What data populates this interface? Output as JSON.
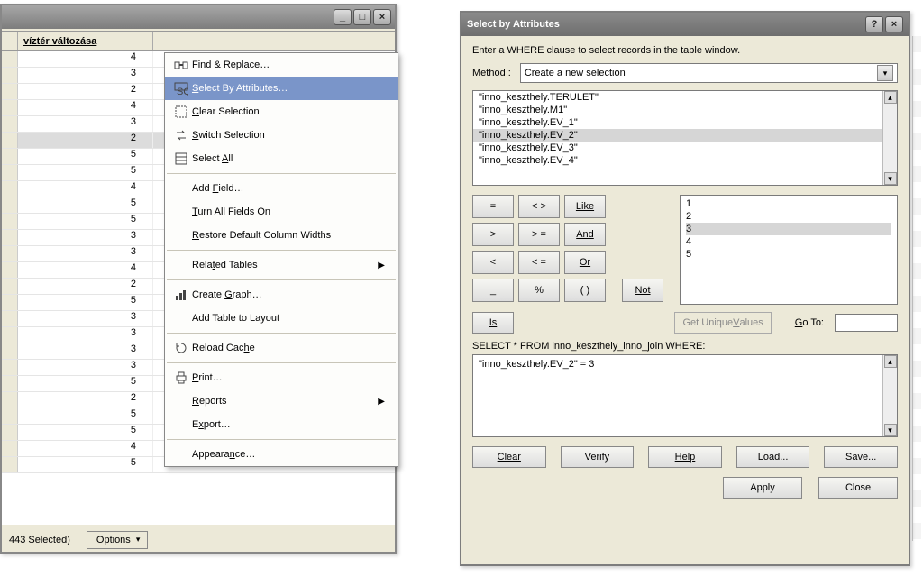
{
  "left": {
    "column_header": "víztér változása",
    "rows": [
      4,
      3,
      2,
      4,
      3,
      2,
      5,
      5,
      4,
      5,
      5,
      3,
      3,
      4,
      2,
      5,
      3,
      3,
      3,
      3,
      5,
      2,
      5,
      5,
      4,
      5
    ],
    "selected_row_index": 5,
    "status": "443 Selected)",
    "options_button": "Options"
  },
  "context_menu": {
    "items": [
      {
        "icon": "binoculars-icon",
        "label": "Find & Replace…",
        "underline": "F"
      },
      {
        "icon": "sql-icon",
        "label": "Select By Attributes…",
        "underline": "S",
        "highlight": true
      },
      {
        "icon": "clear-icon",
        "label": "Clear Selection",
        "underline": "C"
      },
      {
        "icon": "switch-icon",
        "label": "Switch Selection",
        "underline": "S"
      },
      {
        "icon": "select-all-icon",
        "label": "Select All",
        "underline": "A"
      },
      {
        "sep": true
      },
      {
        "label": "Add Field…",
        "underline": "F"
      },
      {
        "label": "Turn All Fields On",
        "underline": "T"
      },
      {
        "label": "Restore Default Column Widths",
        "underline": "R"
      },
      {
        "sep": true
      },
      {
        "label": "Related Tables",
        "underline": "T",
        "submenu": true
      },
      {
        "sep": true
      },
      {
        "icon": "graph-icon",
        "label": "Create Graph…",
        "underline": "G"
      },
      {
        "label": "Add Table to Layout"
      },
      {
        "sep": true
      },
      {
        "icon": "reload-icon",
        "label": "Reload Cache",
        "underline": "h"
      },
      {
        "sep": true
      },
      {
        "icon": "print-icon",
        "label": "Print…",
        "underline": "P"
      },
      {
        "label": "Reports",
        "underline": "R",
        "submenu": true
      },
      {
        "label": "Export…",
        "underline": "x"
      },
      {
        "sep": true
      },
      {
        "label": "Appearance…",
        "underline": "n"
      }
    ]
  },
  "sba": {
    "title": "Select by Attributes",
    "instruction": "Enter a WHERE clause to select records in the table window.",
    "method_label": "Method",
    "method_value": "Create a new selection",
    "fields": [
      "\"inno_keszthely.TERULET\"",
      "\"inno_keszthely.M1\"",
      "\"inno_keszthely.EV_1\"",
      "\"inno_keszthely.EV_2\"",
      "\"inno_keszthely.EV_3\"",
      "\"inno_keszthely.EV_4\""
    ],
    "field_selected_index": 3,
    "ops": {
      "eq": "=",
      "ne": "< >",
      "like": "Like",
      "gt": ">",
      "ge": "> =",
      "and": "And",
      "lt": "<",
      "le": "< =",
      "or": "Or",
      "us": "_",
      "pct": "%",
      "paren": "( )",
      "not": "Not",
      "is": "Is"
    },
    "unique_values": [
      "1",
      "2",
      "3",
      "4",
      "5"
    ],
    "unique_selected_index": 2,
    "get_unique_values": "Get Unique Values",
    "goto_label": "Go To:",
    "select_from": "SELECT * FROM inno_keszthely_inno_join WHERE:",
    "where_text": "\"inno_keszthely.EV_2\" = 3",
    "buttons": {
      "clear": "Clear",
      "verify": "Verify",
      "help": "Help",
      "load": "Load...",
      "save": "Save...",
      "apply": "Apply",
      "close": "Close"
    }
  }
}
